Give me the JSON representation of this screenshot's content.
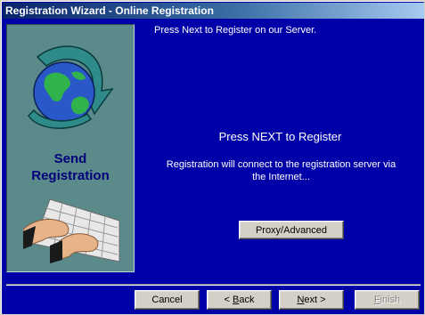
{
  "window": {
    "title": "Registration Wizard - Online Registration"
  },
  "side_panel": {
    "title_line1": "Send",
    "title_line2": "Registration",
    "globe_icon": "globe-with-arrow-icon",
    "keyboard_icon": "hands-on-keyboard-icon"
  },
  "main": {
    "top_message": "Press Next to Register on our Server.",
    "headline": "Press NEXT to Register",
    "detail": "Registration will connect to the registration server via the Internet...",
    "proxy_button": "Proxy/Advanced"
  },
  "footer": {
    "cancel": "Cancel",
    "back_prefix": "< ",
    "back_mnemonic": "B",
    "back_rest": "ack",
    "next_mnemonic": "N",
    "next_rest": "ext >",
    "finish_mnemonic": "F",
    "finish_rest": "inish"
  },
  "colors": {
    "background": "#0000a8",
    "panel": "#5b8a8a",
    "title_gradient_start": "#0a246a",
    "button_face": "#d4d0c8"
  }
}
